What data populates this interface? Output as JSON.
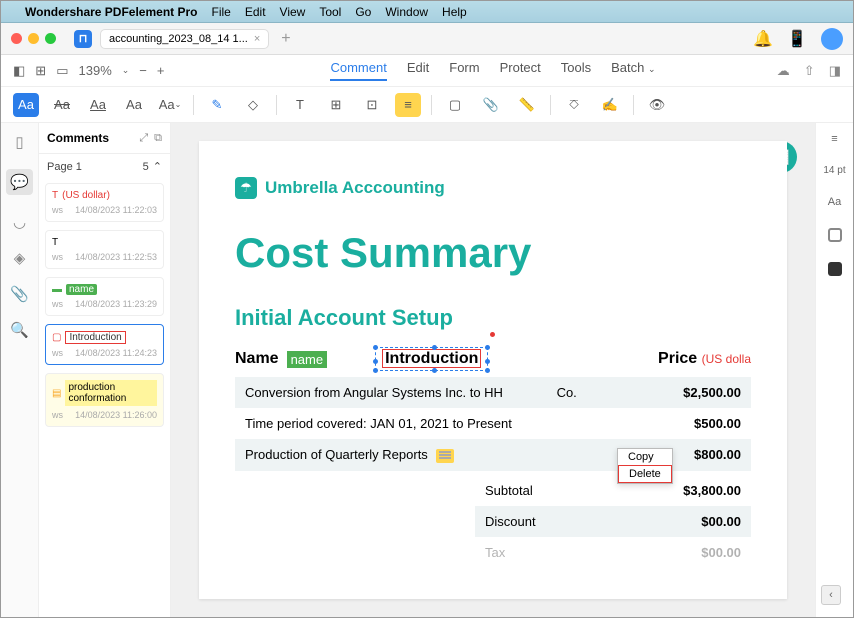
{
  "menubar": {
    "app": "Wondershare PDFelement Pro",
    "items": [
      "File",
      "Edit",
      "View",
      "Tool",
      "Go",
      "Window",
      "Help"
    ]
  },
  "tab": {
    "title": "accounting_2023_08_14 1...",
    "add": "+"
  },
  "zoom": "139%",
  "maintabs": {
    "comment": "Comment",
    "edit": "Edit",
    "form": "Form",
    "protect": "Protect",
    "tools": "Tools",
    "batch": "Batch"
  },
  "comments": {
    "title": "Comments",
    "page_label": "Page 1",
    "count": "5",
    "items": [
      {
        "type": "T",
        "label": "(US dollar)",
        "user": "ws",
        "time": "14/08/2023 11:22:03",
        "style": "red"
      },
      {
        "type": "T",
        "label": "",
        "user": "ws",
        "time": "14/08/2023 11:22:53",
        "style": "plain"
      },
      {
        "type": "H",
        "label": "name",
        "user": "ws",
        "time": "14/08/2023 11:23:29",
        "style": "green"
      },
      {
        "type": "B",
        "label": "Introduction",
        "user": "ws",
        "time": "14/08/2023 11:24:23",
        "style": "box",
        "selected": true
      },
      {
        "type": "N",
        "label": "production conformation",
        "user": "ws",
        "time": "14/08/2023 11:26:00",
        "style": "yellow"
      }
    ]
  },
  "doc": {
    "logo": "Umbrella Acccounting",
    "h1": "Cost Summary",
    "h2": "Initial Account Setup",
    "col_name": "Name",
    "col_price": "Price",
    "usd": "(US dolla",
    "hl_name": "name",
    "intro": "Introduction",
    "rows": [
      {
        "desc": "Conversion from Angular Systems Inc. to HH",
        "suffix": "Co.",
        "val": "$2,500.00"
      },
      {
        "desc": "Time period covered: JAN 01, 2021 to Present",
        "val": "$500.00"
      },
      {
        "desc": "Production of Quarterly Reports",
        "val": "$800.00",
        "note": true
      }
    ],
    "totals": [
      {
        "label": "Subtotal",
        "val": "$3,800.00"
      },
      {
        "label": "Discount",
        "val": "$00.00"
      },
      {
        "label": "Tax",
        "val": "$00.00"
      }
    ]
  },
  "ctx": {
    "copy": "Copy",
    "delete": "Delete"
  },
  "right": {
    "pt": "14 pt",
    "aa": "Aa"
  }
}
